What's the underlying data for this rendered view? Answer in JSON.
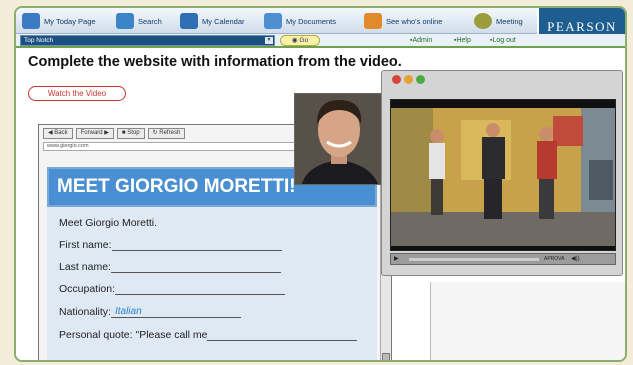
{
  "toolbar": {
    "items": [
      {
        "label": "My Today Page",
        "icon": "calendar-page-icon",
        "color": "#3b7bc4"
      },
      {
        "label": "Search",
        "icon": "search-icon",
        "color": "#3b84c6"
      },
      {
        "label": "My Calendar",
        "icon": "calendar-icon",
        "color": "#2f6fb4"
      },
      {
        "label": "My Documents",
        "icon": "folder-icon",
        "color": "#4d8fd0"
      },
      {
        "label": "See who's online",
        "icon": "people-icon",
        "color": "#e08a2c"
      },
      {
        "label": "Meeting",
        "icon": "meeting-icon",
        "color": "#9c9c3a"
      }
    ],
    "brand": "PEARSON"
  },
  "nav": {
    "combo_value": "Top Notch",
    "go_label": "Go",
    "links": [
      "Admin",
      "Help",
      "Log out"
    ]
  },
  "main": {
    "instruction": "Complete the website with information from the video.",
    "watch_button": "Watch the Video"
  },
  "browser": {
    "buttons": [
      "Back",
      "Forward",
      "Stop",
      "Refresh"
    ],
    "address": "www.giorgio.com",
    "banner": "MEET GIORGIO MORETTI!",
    "form": {
      "intro": "Meet Giorgio Moretti.",
      "first_name_label": "First name:",
      "last_name_label": "Last name:",
      "occupation_label": "Occupation:",
      "nationality_label": "Nationality:",
      "nationality_value": "Italian",
      "quote_label": "Personal quote: \"Please call me"
    }
  },
  "player": {
    "control_text": "APROVA"
  }
}
